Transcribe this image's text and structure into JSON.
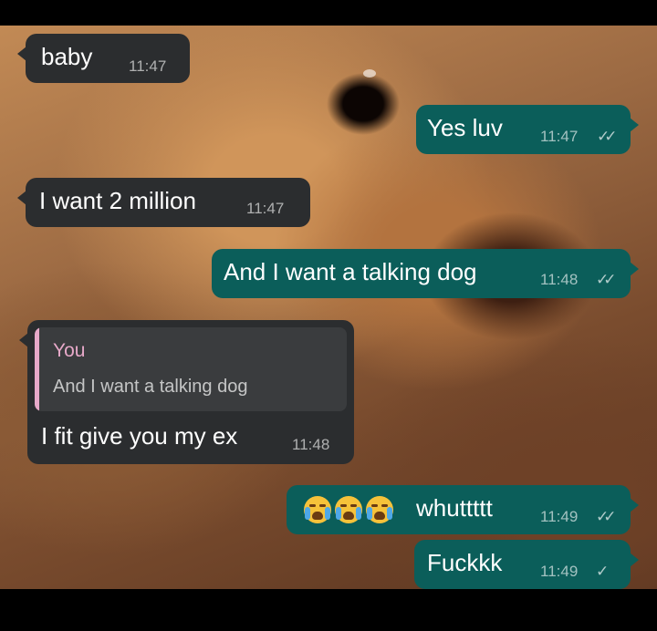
{
  "messages": [
    {
      "direction": "incoming",
      "text": "baby",
      "time": "11:47"
    },
    {
      "direction": "outgoing",
      "text": "Yes luv",
      "time": "11:47",
      "status": "read"
    },
    {
      "direction": "incoming",
      "text": "I want 2 million",
      "time": "11:47"
    },
    {
      "direction": "outgoing",
      "text": "And I want a talking dog",
      "time": "11:48",
      "status": "read"
    },
    {
      "direction": "incoming",
      "text": "I fit give you my ex",
      "time": "11:48",
      "reply": {
        "author": "You",
        "text": "And I want a talking dog"
      }
    },
    {
      "direction": "outgoing",
      "text": "whuttttt",
      "emoji_prefix": [
        "loudly-crying-face-emoji",
        "loudly-crying-face-emoji",
        "loudly-crying-face-emoji"
      ],
      "time": "11:49",
      "status": "read"
    },
    {
      "direction": "outgoing",
      "text": "Fuckkk",
      "time": "11:49",
      "status": "delivered"
    }
  ],
  "ticks": {
    "read": "✓✓",
    "delivered": "✓"
  },
  "colors": {
    "incoming_bubble": "#2b2d2f",
    "outgoing_bubble": "#0b5e5a",
    "reply_accent": "#e7a9c9"
  }
}
